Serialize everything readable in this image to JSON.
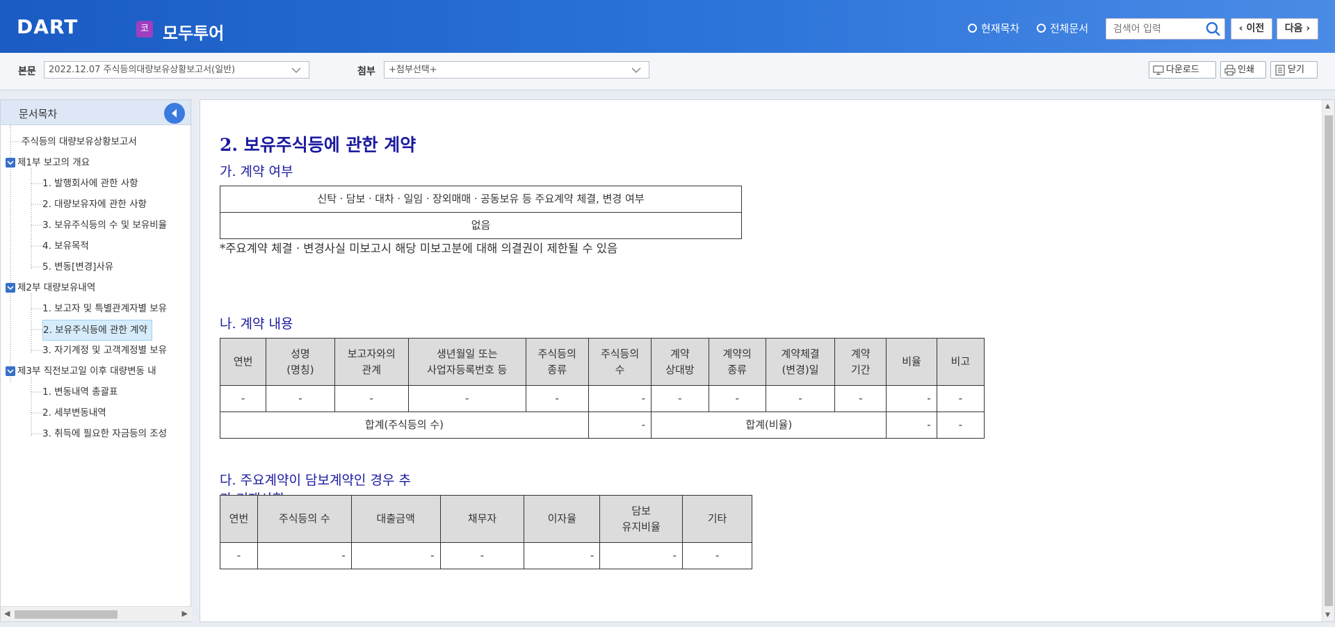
{
  "header": {
    "logo": "DART",
    "company_badge": "코",
    "company_name": "모두투어",
    "radio_current": "현재목차",
    "radio_all": "전체문서",
    "search_placeholder": "검색어 입력",
    "prev_label": "이전",
    "next_label": "다음"
  },
  "toolbar": {
    "main_label": "본문",
    "main_select": "2022.12.07  주식등의대량보유상황보고서(일반)",
    "attach_label": "첨부",
    "attach_select": "+첨부선택+",
    "download": "다운로드",
    "print": "인쇄",
    "close": "닫기"
  },
  "sidebar": {
    "title": "문서목차",
    "items": [
      {
        "label": "주식등의 대량보유상황보고서"
      },
      {
        "label": "제1부 보고의 개요"
      },
      {
        "label": "1. 발행회사에 관한 사항"
      },
      {
        "label": "2. 대량보유자에 관한 사항"
      },
      {
        "label": "3. 보유주식등의 수 및 보유비율"
      },
      {
        "label": "4. 보유목적"
      },
      {
        "label": "5. 변동[변경]사유"
      },
      {
        "label": "제2부 대량보유내역"
      },
      {
        "label": "1. 보고자 및 특별관계자별 보유"
      },
      {
        "label": "2. 보유주식등에 관한 계약"
      },
      {
        "label": "3. 자기계정 및 고객계정별 보유"
      },
      {
        "label": "제3부 직전보고일 이후 대량변동 내"
      },
      {
        "label": "1. 변동내역 총괄표"
      },
      {
        "label": "2. 세부변동내역"
      },
      {
        "label": "3. 취득에 필요한 자금등의 조성"
      }
    ]
  },
  "document": {
    "title": "2. 보유주식등에 관한 계약",
    "section_a": {
      "heading": "가. 계약 여부",
      "table_header": "신탁ㆍ담보ㆍ대차ㆍ일임ㆍ장외매매ㆍ공동보유 등 주요계약 체결, 변경 여부",
      "table_value": "없음",
      "note": "*주요계약 체결 · 변경사실 미보고시 해당 미보고분에 대해 의결권이 제한될 수 있음"
    },
    "section_b": {
      "heading": "나. 계약 내용",
      "headers": [
        "연번",
        "성명\n(명칭)",
        "보고자와의\n관계",
        "생년월일 또는\n사업자등록번호 등",
        "주식등의\n종류",
        "주식등의\n수",
        "계약\n상대방",
        "계약의\n종류",
        "계약체결\n(변경)일",
        "계약\n기간",
        "비율",
        "비고"
      ],
      "row": [
        "-",
        "-",
        "-",
        "-",
        "-",
        "-",
        "-",
        "-",
        "-",
        "-",
        "-",
        "-"
      ],
      "total_shares_label": "합계(주식등의 수)",
      "total_shares_value": "-",
      "total_ratio_label": "합계(비율)",
      "total_ratio_value": "-",
      "total_note": "-"
    },
    "section_c": {
      "heading": "다. 주요계약이 담보계약인 경우 추가 기재사항",
      "headers": [
        "연번",
        "주식등의 수",
        "대출금액",
        "채무자",
        "이자율",
        "담보\n유지비율",
        "기타"
      ],
      "row": [
        "-",
        "-",
        "-",
        "-",
        "-",
        "-",
        "-"
      ]
    }
  }
}
